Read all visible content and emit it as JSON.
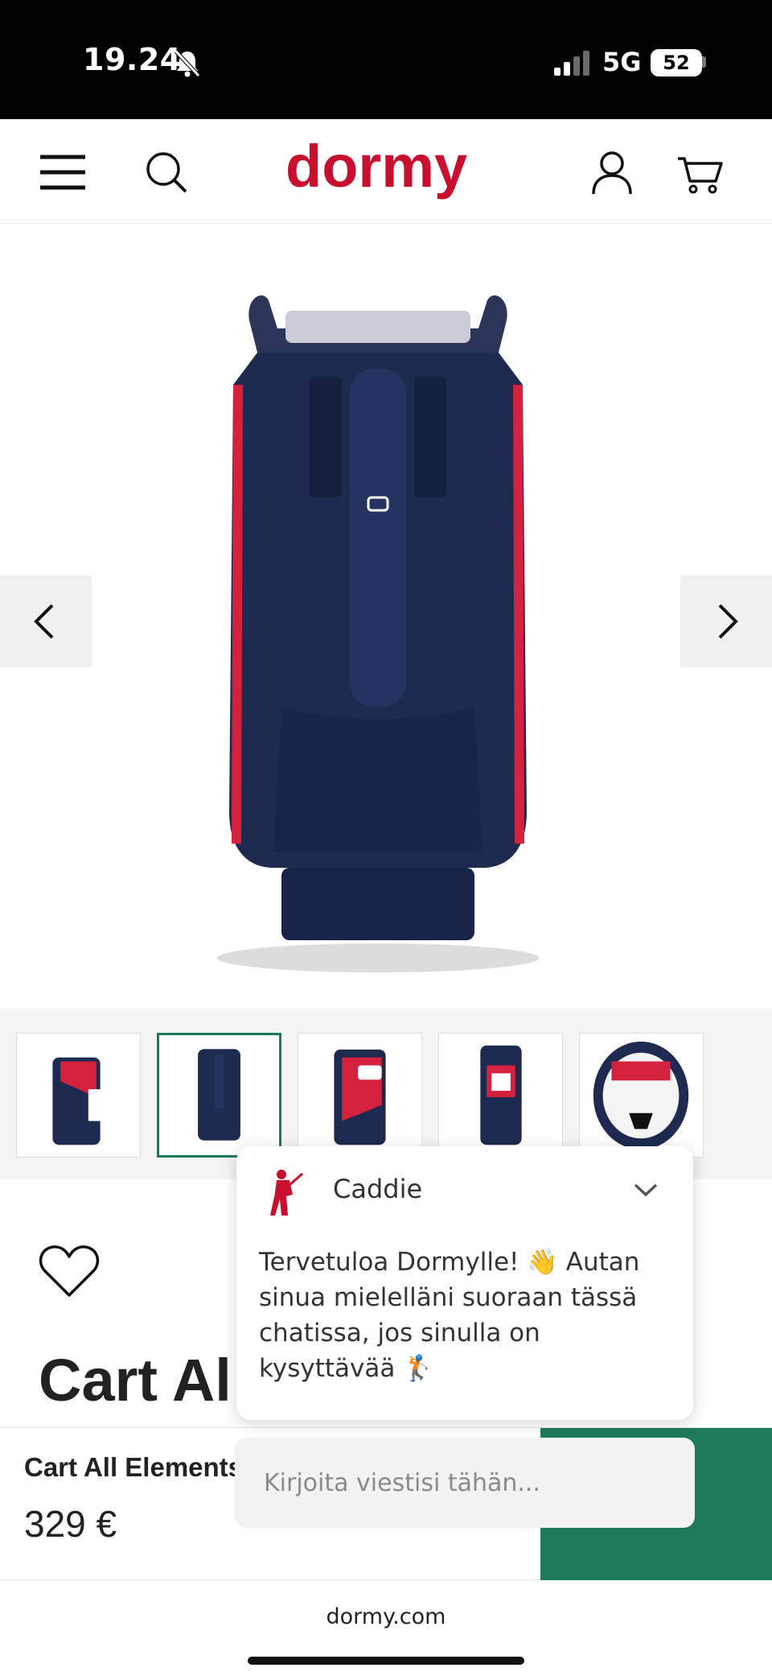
{
  "status_bar": {
    "time": "19.24",
    "network": "5G",
    "battery": "52"
  },
  "header": {
    "logo_text": "dormy",
    "brand_color": "#c8102e",
    "icons": [
      "menu-icon",
      "search-icon",
      "account-icon",
      "cart-icon"
    ]
  },
  "gallery": {
    "thumbnail_count": 5,
    "selected_index": 1,
    "colors": {
      "bag_navy": "#1e2a4f",
      "bag_red": "#d4213d"
    }
  },
  "product": {
    "title_visible": "Cart Al",
    "sticky_name": "Cart All Elements",
    "price": "329 €",
    "accent_color": "#1c7a5a"
  },
  "chat": {
    "name": "Caddie",
    "message": "Tervetuloa Dormylle! 👋 Autan sinua mielelläni suoraan tässä chatissa, jos sinulla on kysyttävää 🏌️",
    "input_placeholder": "Kirjoita viestisi tähän..."
  },
  "browser": {
    "url": "dormy.com"
  }
}
